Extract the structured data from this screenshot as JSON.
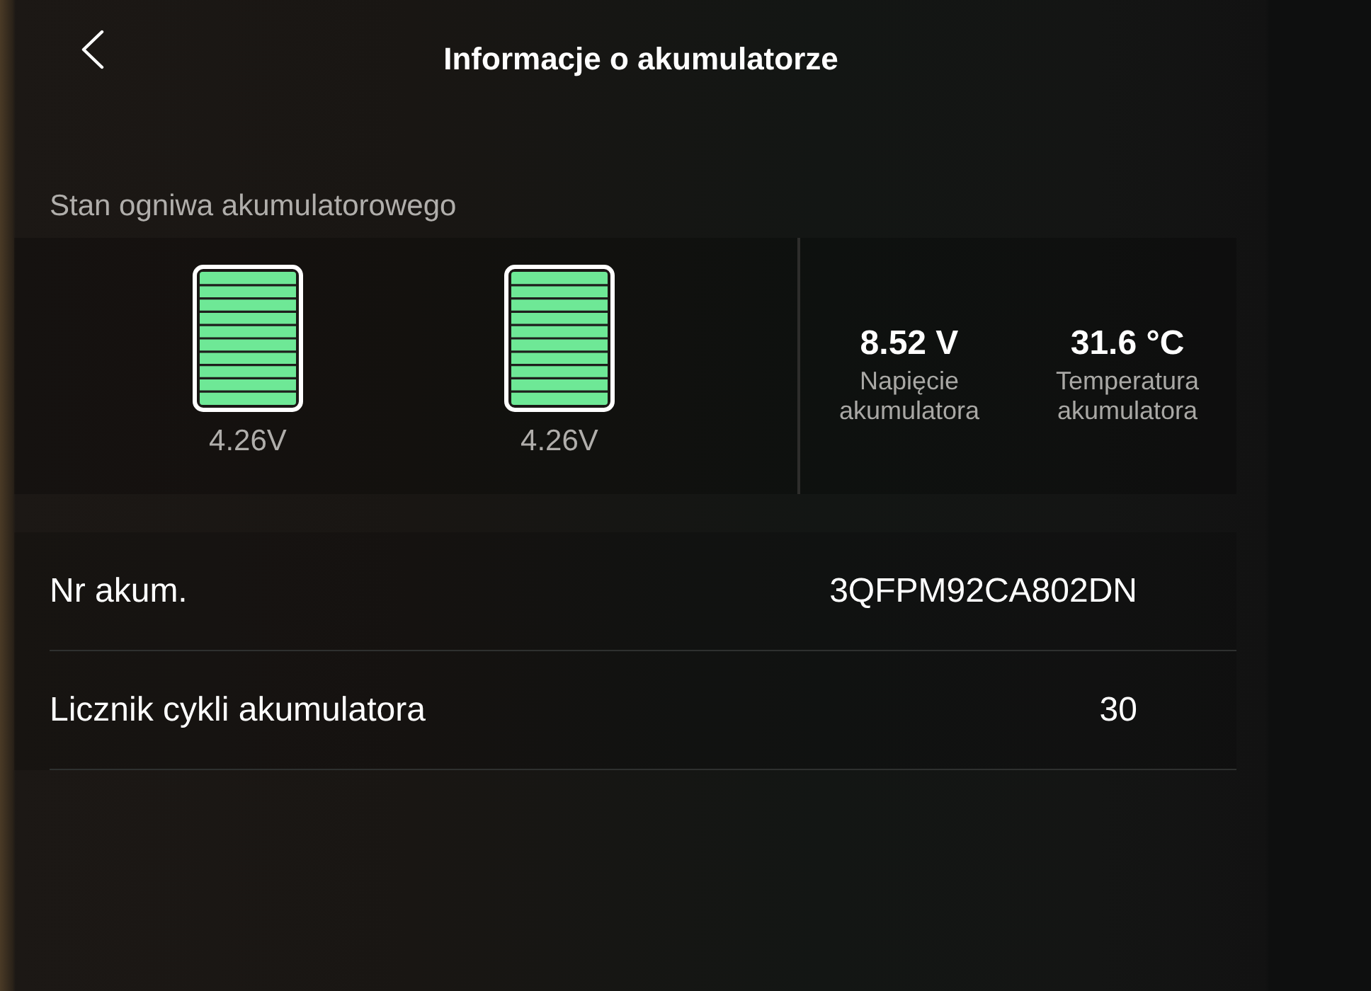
{
  "header": {
    "title": "Informacje o akumulatorze"
  },
  "cell_section": {
    "label": "Stan ogniwa akumulatorowego",
    "cells": [
      {
        "level": 1,
        "voltage": "4.26V"
      },
      {
        "level": 1,
        "voltage": "4.26V"
      }
    ],
    "stats": [
      {
        "value": "8.52 V",
        "label": "Napięcie akumulatora"
      },
      {
        "value": "31.6 °C",
        "label": "Temperatura akumulatora"
      }
    ]
  },
  "info_rows": [
    {
      "label": "Nr akum.",
      "value": "3QFPM92CA802DN"
    },
    {
      "label": "Licznik cykli akumulatora",
      "value": "30"
    }
  ]
}
